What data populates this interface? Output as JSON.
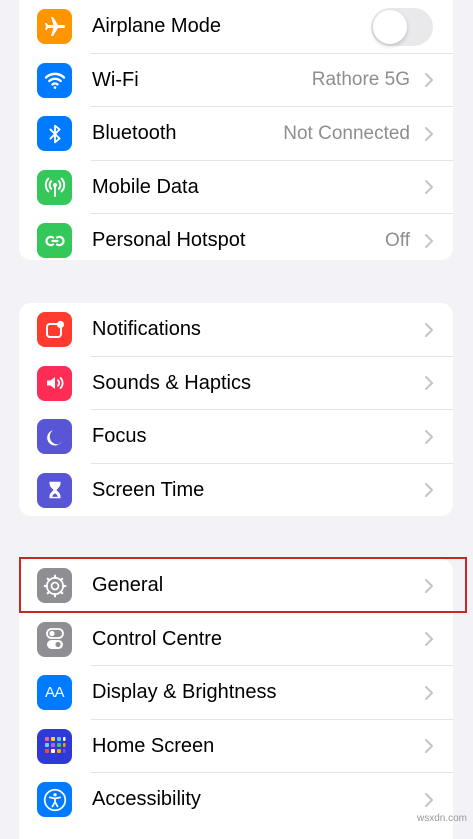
{
  "colors": {
    "background": "#f2f2f7",
    "orange": "#ff9500",
    "blue": "#007aff",
    "green": "#34c759",
    "red": "#ff3b30",
    "pink": "#ff2d55",
    "indigo": "#5856d6",
    "gray": "#8e8e93",
    "highlight": "#c62828"
  },
  "groups": [
    {
      "rows": [
        {
          "label": "Airplane Mode",
          "icon": "airplane-icon",
          "control": "toggle",
          "toggle_on": false
        },
        {
          "label": "Wi-Fi",
          "icon": "wifi-icon",
          "value": "Rathore 5G"
        },
        {
          "label": "Bluetooth",
          "icon": "bluetooth-icon",
          "value": "Not Connected"
        },
        {
          "label": "Mobile Data",
          "icon": "antenna-icon"
        },
        {
          "label": "Personal Hotspot",
          "icon": "hotspot-link-icon",
          "value": "Off"
        }
      ]
    },
    {
      "rows": [
        {
          "label": "Notifications",
          "icon": "notification-bell-icon"
        },
        {
          "label": "Sounds & Haptics",
          "icon": "speaker-icon"
        },
        {
          "label": "Focus",
          "icon": "moon-icon"
        },
        {
          "label": "Screen Time",
          "icon": "hourglass-icon"
        }
      ]
    },
    {
      "rows": [
        {
          "label": "General",
          "icon": "gear-icon",
          "highlighted": true
        },
        {
          "label": "Control Centre",
          "icon": "toggles-icon"
        },
        {
          "label": "Display & Brightness",
          "icon": "text-size-icon",
          "icon_text": "AA"
        },
        {
          "label": "Home Screen",
          "icon": "app-grid-icon"
        },
        {
          "label": "Accessibility",
          "icon": "accessibility-person-icon"
        }
      ]
    }
  ],
  "watermark": "wsxdn.com"
}
